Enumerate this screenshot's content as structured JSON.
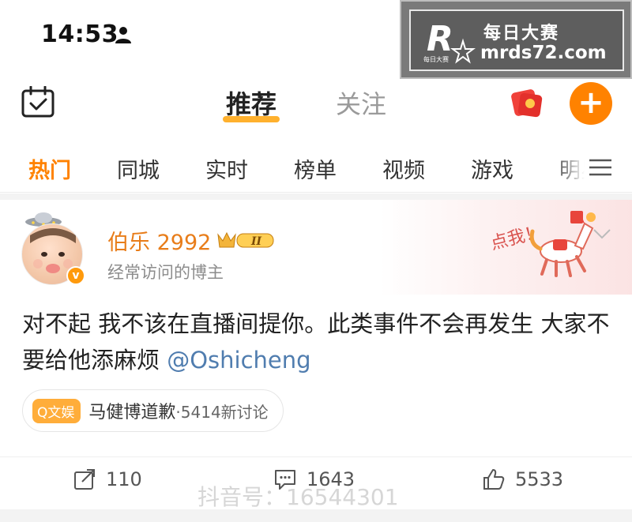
{
  "status_bar": {
    "time": "14:53"
  },
  "watermark": {
    "title": "每日大赛",
    "url": "mrds72.com",
    "logo_letter": "R",
    "logo_sub": "每日大赛"
  },
  "top_nav": {
    "tabs": [
      {
        "label": "推荐",
        "active": true
      },
      {
        "label": "关注",
        "active": false
      }
    ]
  },
  "categories": {
    "items": [
      "热门",
      "同城",
      "实时",
      "榜单",
      "视频",
      "游戏",
      "明星"
    ],
    "active_index": 0
  },
  "post": {
    "username": "伯乐 2992",
    "badge_level": "II",
    "user_subtitle": "经常访问的博主",
    "text": "对不起 我不该在直播间提你。此类事件不会再发生 大家不要给他添麻烦 ",
    "mention": "@Oshicheng",
    "decoration_text": "点我！",
    "topic": {
      "tag": "Q文娱",
      "title": "马健博道歉",
      "count": "·5414新讨论"
    },
    "actions": {
      "reposts": "110",
      "comments": "1643",
      "likes": "5533"
    }
  },
  "bottom_watermark": "抖音号：16544301",
  "colors": {
    "accent": "#ff8200",
    "username": "#e87d1a",
    "mention": "#507daf",
    "underline": "#ffb12e"
  }
}
